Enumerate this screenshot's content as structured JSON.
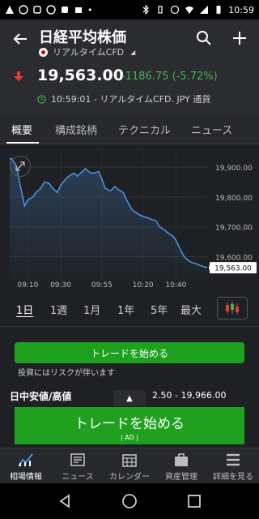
{
  "status_bar": {
    "time": "10:59"
  },
  "header": {
    "title": "日経平均株価",
    "subtitle": "リアルタイムCFD"
  },
  "price": {
    "value": "19,563.00",
    "change": "-1186.75 (-5.72%)",
    "timestamp": "10:59:01 - リアルタイムCFD. JPY 通貨"
  },
  "tabs": [
    {
      "label": "概要"
    },
    {
      "label": "構成銘柄"
    },
    {
      "label": "テクニカル"
    },
    {
      "label": "ニュース"
    }
  ],
  "chart_data": {
    "type": "line",
    "x": [
      "08:59",
      "09:00",
      "09:03",
      "09:05",
      "09:08",
      "09:10",
      "09:13",
      "09:15",
      "09:18",
      "09:20",
      "09:23",
      "09:25",
      "09:28",
      "09:30",
      "09:33",
      "09:35",
      "09:38",
      "09:40",
      "09:43",
      "09:45",
      "09:48",
      "09:50",
      "09:53",
      "09:55",
      "09:57",
      "10:00",
      "10:03",
      "10:05",
      "10:08",
      "10:10",
      "10:13",
      "10:15",
      "10:18",
      "10:20",
      "10:23",
      "10:25",
      "10:28",
      "10:30",
      "10:33",
      "10:35",
      "10:38",
      "10:40",
      "10:43",
      "10:45",
      "10:48",
      "10:50",
      "10:53",
      "10:55",
      "10:59"
    ],
    "series": [
      {
        "values": [
          19925,
          19930,
          19905,
          19850,
          19770,
          19790,
          19800,
          19815,
          19830,
          19850,
          19845,
          19830,
          19815,
          19840,
          19860,
          19870,
          19880,
          19870,
          19885,
          19895,
          19880,
          19880,
          19885,
          19860,
          19830,
          19820,
          19835,
          19825,
          19815,
          19790,
          19760,
          19750,
          19740,
          19735,
          19730,
          19725,
          19720,
          19700,
          19690,
          19680,
          19670,
          19655,
          19620,
          19600,
          19585,
          19580,
          19575,
          19570,
          19563
        ]
      }
    ],
    "y_ticks": [
      "19,900.00",
      "19,800.00",
      "19,700.00",
      "19,600.00"
    ],
    "x_ticks": [
      "09:10",
      "09:30",
      "09:55",
      "10:20",
      "10:40"
    ],
    "last_label": "19,563.00",
    "ylim": [
      19520,
      19960
    ],
    "grid": true,
    "line_color": "#4a90e2"
  },
  "periods": [
    {
      "label": "1日"
    },
    {
      "label": "1週"
    },
    {
      "label": "1月"
    },
    {
      "label": "1年"
    },
    {
      "label": "5年"
    },
    {
      "label": "最大"
    }
  ],
  "trade_button": "トレードを始める",
  "risk_note": "投資にはリスクが伴います",
  "day_range": {
    "label": "日中安値/高値",
    "value": "2.50 - 19,966.00"
  },
  "ad": {
    "title": "トレードを始める",
    "tag": "| AD |"
  },
  "bottom_nav": [
    {
      "label": "相場情報"
    },
    {
      "label": "ニュース"
    },
    {
      "label": "カレンダー"
    },
    {
      "label": "資産管理"
    },
    {
      "label": "詳細を見る"
    }
  ],
  "colors": {
    "accent_green": "#1fa11f",
    "down_red": "#e53935",
    "up_green_text": "#4caf50"
  }
}
